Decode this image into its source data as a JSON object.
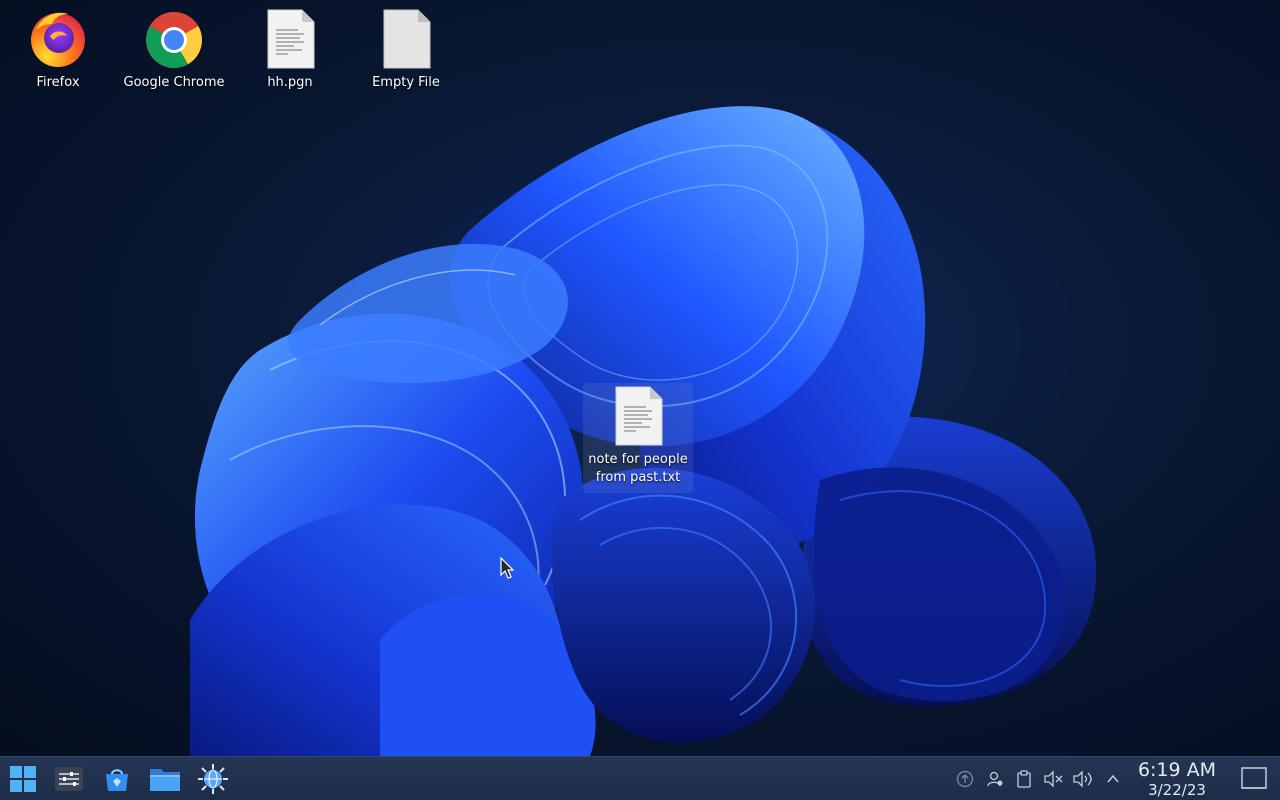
{
  "desktop": {
    "icons": [
      {
        "name": "firefox",
        "label": "Firefox",
        "icon": "firefox-icon"
      },
      {
        "name": "google-chrome",
        "label": "Google Chrome",
        "icon": "chrome-icon"
      },
      {
        "name": "hh-pgn",
        "label": "hh.pgn",
        "icon": "text-file-icon"
      },
      {
        "name": "empty-file",
        "label": "Empty File",
        "icon": "blank-file-icon"
      },
      {
        "name": "note-file",
        "label_line1": "note for people",
        "label_line2": "from past.txt",
        "icon": "text-file-icon"
      }
    ]
  },
  "taskbar": {
    "apps": [
      {
        "name": "start-menu",
        "icon": "windows-logo-icon"
      },
      {
        "name": "system-settings",
        "icon": "settings-sliders-icon"
      },
      {
        "name": "software-store",
        "icon": "store-bag-icon"
      },
      {
        "name": "file-manager",
        "icon": "folder-icon"
      },
      {
        "name": "network-tool",
        "icon": "globe-gear-icon"
      }
    ],
    "tray": [
      {
        "name": "updates",
        "icon": "arrow-up-circle-icon"
      },
      {
        "name": "user-status",
        "icon": "user-icon"
      },
      {
        "name": "clipboard",
        "icon": "clipboard-icon"
      },
      {
        "name": "microphone-muted",
        "icon": "speaker-muted-icon"
      },
      {
        "name": "volume",
        "icon": "speaker-icon"
      },
      {
        "name": "expand-tray",
        "icon": "chevron-up-icon"
      }
    ],
    "clock": {
      "time": "6:19 AM",
      "date": "3/22/23"
    }
  },
  "colors": {
    "taskbar_bg": "#1d2c48",
    "wallpaper_accent": "#1e4fff",
    "desktop_bg": "#07132a"
  }
}
